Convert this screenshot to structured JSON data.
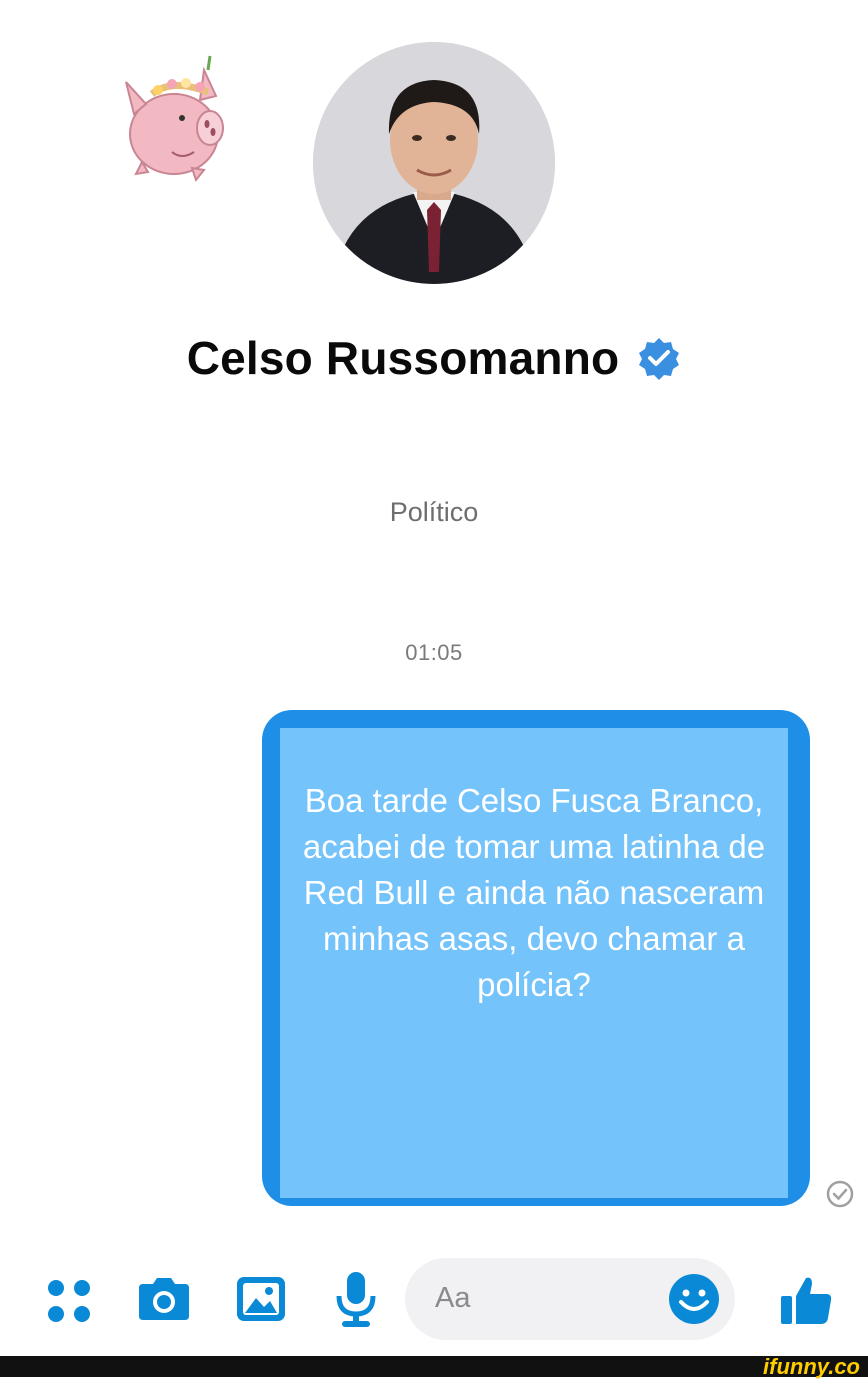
{
  "profile": {
    "name": "Celso Russomanno",
    "subtitle": "Político"
  },
  "conversation": {
    "timestamp": "01:05",
    "message": "Boa tarde Celso Fusca Branco, acabei de tomar uma latinha de Red Bull e ainda não nasceram minhas asas, devo chamar a polícia?"
  },
  "composer": {
    "placeholder": "Aa"
  },
  "toolbar": {
    "icons": [
      "menu-dots-icon",
      "camera-icon",
      "gallery-icon",
      "microphone-icon",
      "emoji-icon",
      "thumbs-up-icon"
    ]
  },
  "watermark": {
    "text": "ifunny.co"
  },
  "colors": {
    "accent": "#0a8ad6",
    "bubble_border": "#1f8ee6",
    "bubble_fill": "#74c3fb",
    "verified": "#3b8fe0",
    "sticker_pink": "#f2b9c3"
  }
}
